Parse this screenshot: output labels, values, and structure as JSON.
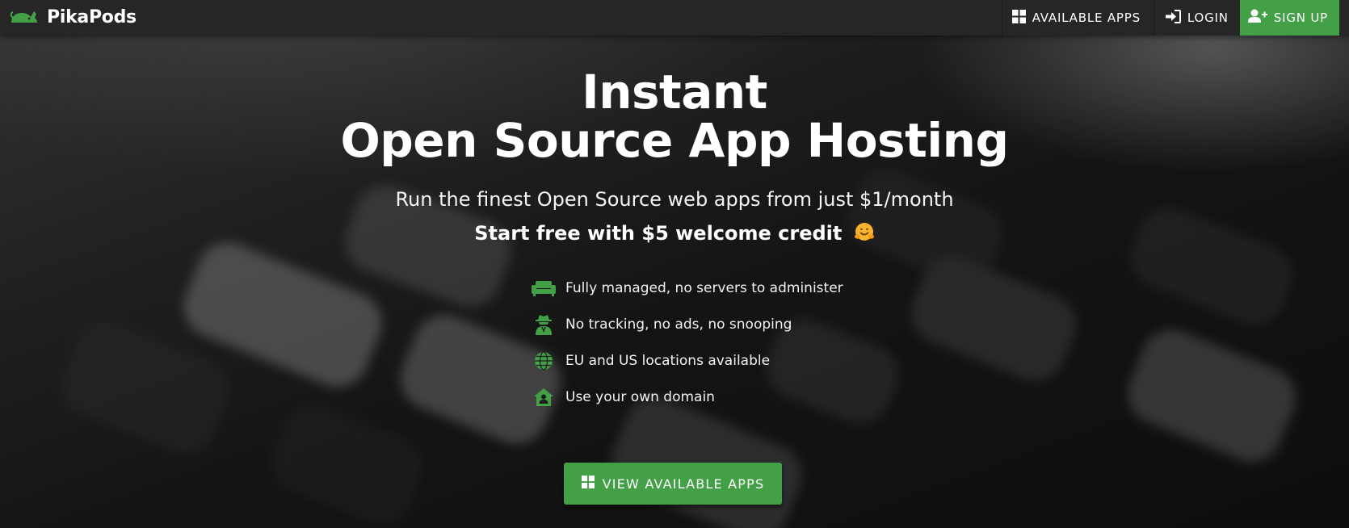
{
  "colors": {
    "accent": "#43a047",
    "navbar": "#262626",
    "text": "#ffffff"
  },
  "navbar": {
    "brand_name": "PikaPods",
    "brand_icon": "pika-logo-icon",
    "available_apps_label": "AVAILABLE APPS",
    "available_apps_icon": "windows-grid-icon",
    "login_label": "LOGIN",
    "login_icon": "sign-in-icon",
    "signup_label": "SIGN UP",
    "signup_icon": "user-plus-icon"
  },
  "hero": {
    "title_line1": "Instant",
    "title_line2": "Open Source App Hosting",
    "subtitle": "Run the finest Open Source web apps from just $1/month",
    "credit_text": "Start free with $5 welcome credit",
    "credit_emoji": "hugging-face-emoji",
    "features": [
      {
        "icon": "couch-icon",
        "text": "Fully managed, no servers to administer"
      },
      {
        "icon": "user-secret-icon",
        "text": "No tracking, no ads, no snooping"
      },
      {
        "icon": "globe-icon",
        "text": "EU and US locations available"
      },
      {
        "icon": "house-user-icon",
        "text": "Use your own domain"
      }
    ],
    "cta_label": "VIEW AVAILABLE APPS",
    "cta_icon": "windows-grid-icon"
  }
}
